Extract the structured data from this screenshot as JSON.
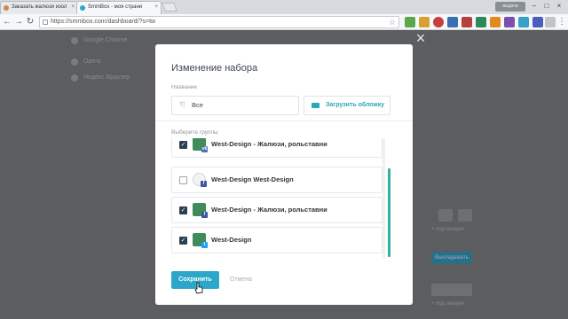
{
  "browser": {
    "tabs": [
      {
        "label": "Заказать жалюзи изол",
        "active": false
      },
      {
        "label": "SmmBox - моя страни",
        "active": true
      }
    ],
    "user_badge": "выдача",
    "url": "https://smmbox.com/dashboard/?s=tw"
  },
  "background": {
    "browsers": [
      "Google Chrome",
      "Opera",
      "Яндекс.Браузер"
    ],
    "right_link_1": "+ под аккаунт",
    "right_button": "Выкладывать",
    "right_link_2": "+ под аккаунт"
  },
  "modal": {
    "title": "Изменение набора",
    "name_label": "Название",
    "name_value": "Все",
    "upload_label": "Загрузить обложку",
    "groups_label": "Выберите группы",
    "groups": [
      {
        "name": "West-Design - Жалюзи, рольставни",
        "checked": true,
        "network": "vk"
      },
      {
        "name": "West-Design West-Design",
        "checked": false,
        "network": "f"
      },
      {
        "name": "West-Design - Жалюзи, рольставни",
        "checked": true,
        "network": "f"
      },
      {
        "name": "West-Design",
        "checked": true,
        "network": "tw"
      }
    ],
    "save_label": "Сохранить",
    "cancel_label": "Отмена"
  },
  "colors": {
    "accent": "#2ca7c9",
    "scroll": "#2fb19b",
    "checkbox_on": "#2b3f52"
  }
}
